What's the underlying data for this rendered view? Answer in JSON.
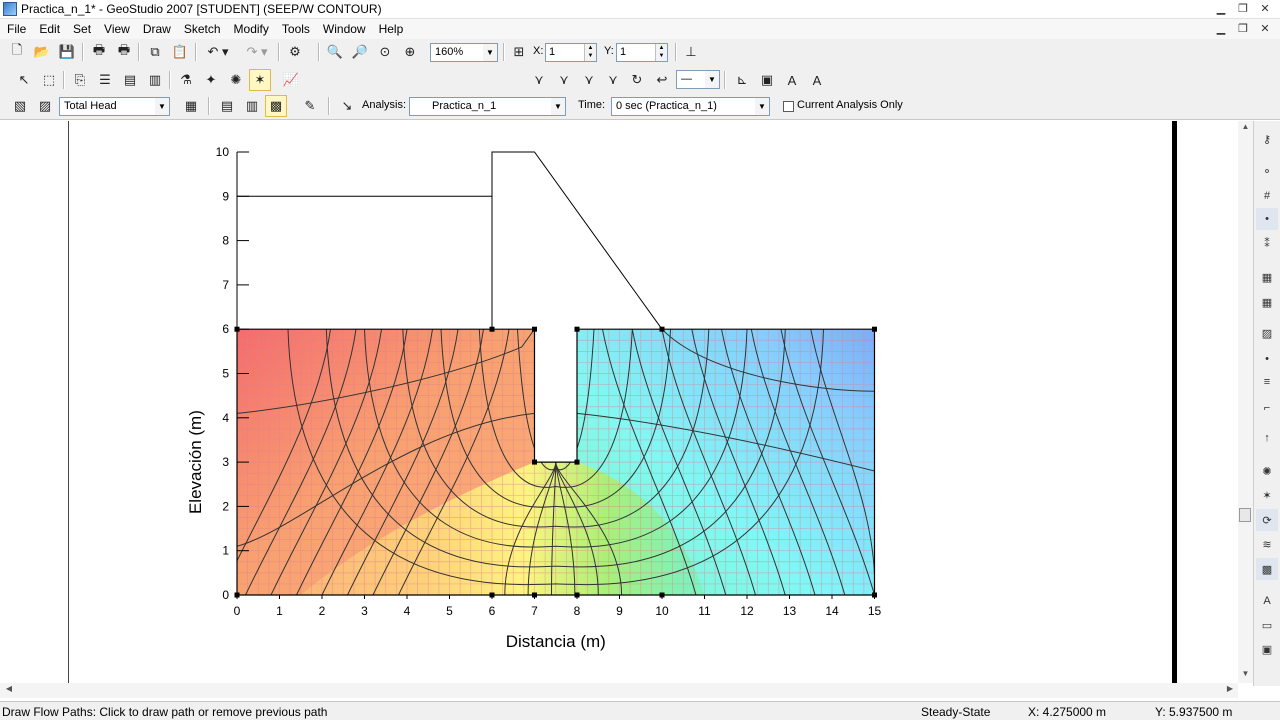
{
  "window": {
    "title": "Practica_n_1* - GeoStudio 2007 [STUDENT] (SEEP/W CONTOUR)"
  },
  "menu": [
    "File",
    "Edit",
    "Set",
    "View",
    "Draw",
    "Sketch",
    "Modify",
    "Tools",
    "Window",
    "Help"
  ],
  "toolbar": {
    "zoom_value": "160%",
    "x_label": "X:",
    "x_value": "1",
    "y_label": "Y:",
    "y_value": "1",
    "contour_param": "Total Head",
    "analysis_label": "Analysis:",
    "analysis_value": "Practica_n_1",
    "time_label": "Time:",
    "time_value": "0 sec (Practica_n_1)",
    "current_analysis_label": "Current Analysis Only"
  },
  "plot": {
    "ylabel": "Elevación (m)",
    "xlabel": "Distancia (m)",
    "xticks": [
      "0",
      "1",
      "2",
      "3",
      "4",
      "5",
      "6",
      "7",
      "8",
      "9",
      "10",
      "11",
      "12",
      "13",
      "14",
      "15"
    ],
    "yticks": [
      "0",
      "1",
      "2",
      "3",
      "4",
      "5",
      "6",
      "7",
      "8",
      "9",
      "10"
    ],
    "xlim": [
      0,
      15
    ],
    "ylim": [
      0,
      10
    ],
    "colors": {
      "high_head": "#f47a7a",
      "mid_head": "#ffff80",
      "low_head": "#7fb0ff",
      "grid": "#e08090",
      "contour": "#333333"
    }
  },
  "status": {
    "message": "Draw Flow Paths:  Click to draw path or remove previous path",
    "mode": "Steady-State",
    "x": "X: 4.275000 m",
    "y": "Y: 5.937500 m"
  }
}
